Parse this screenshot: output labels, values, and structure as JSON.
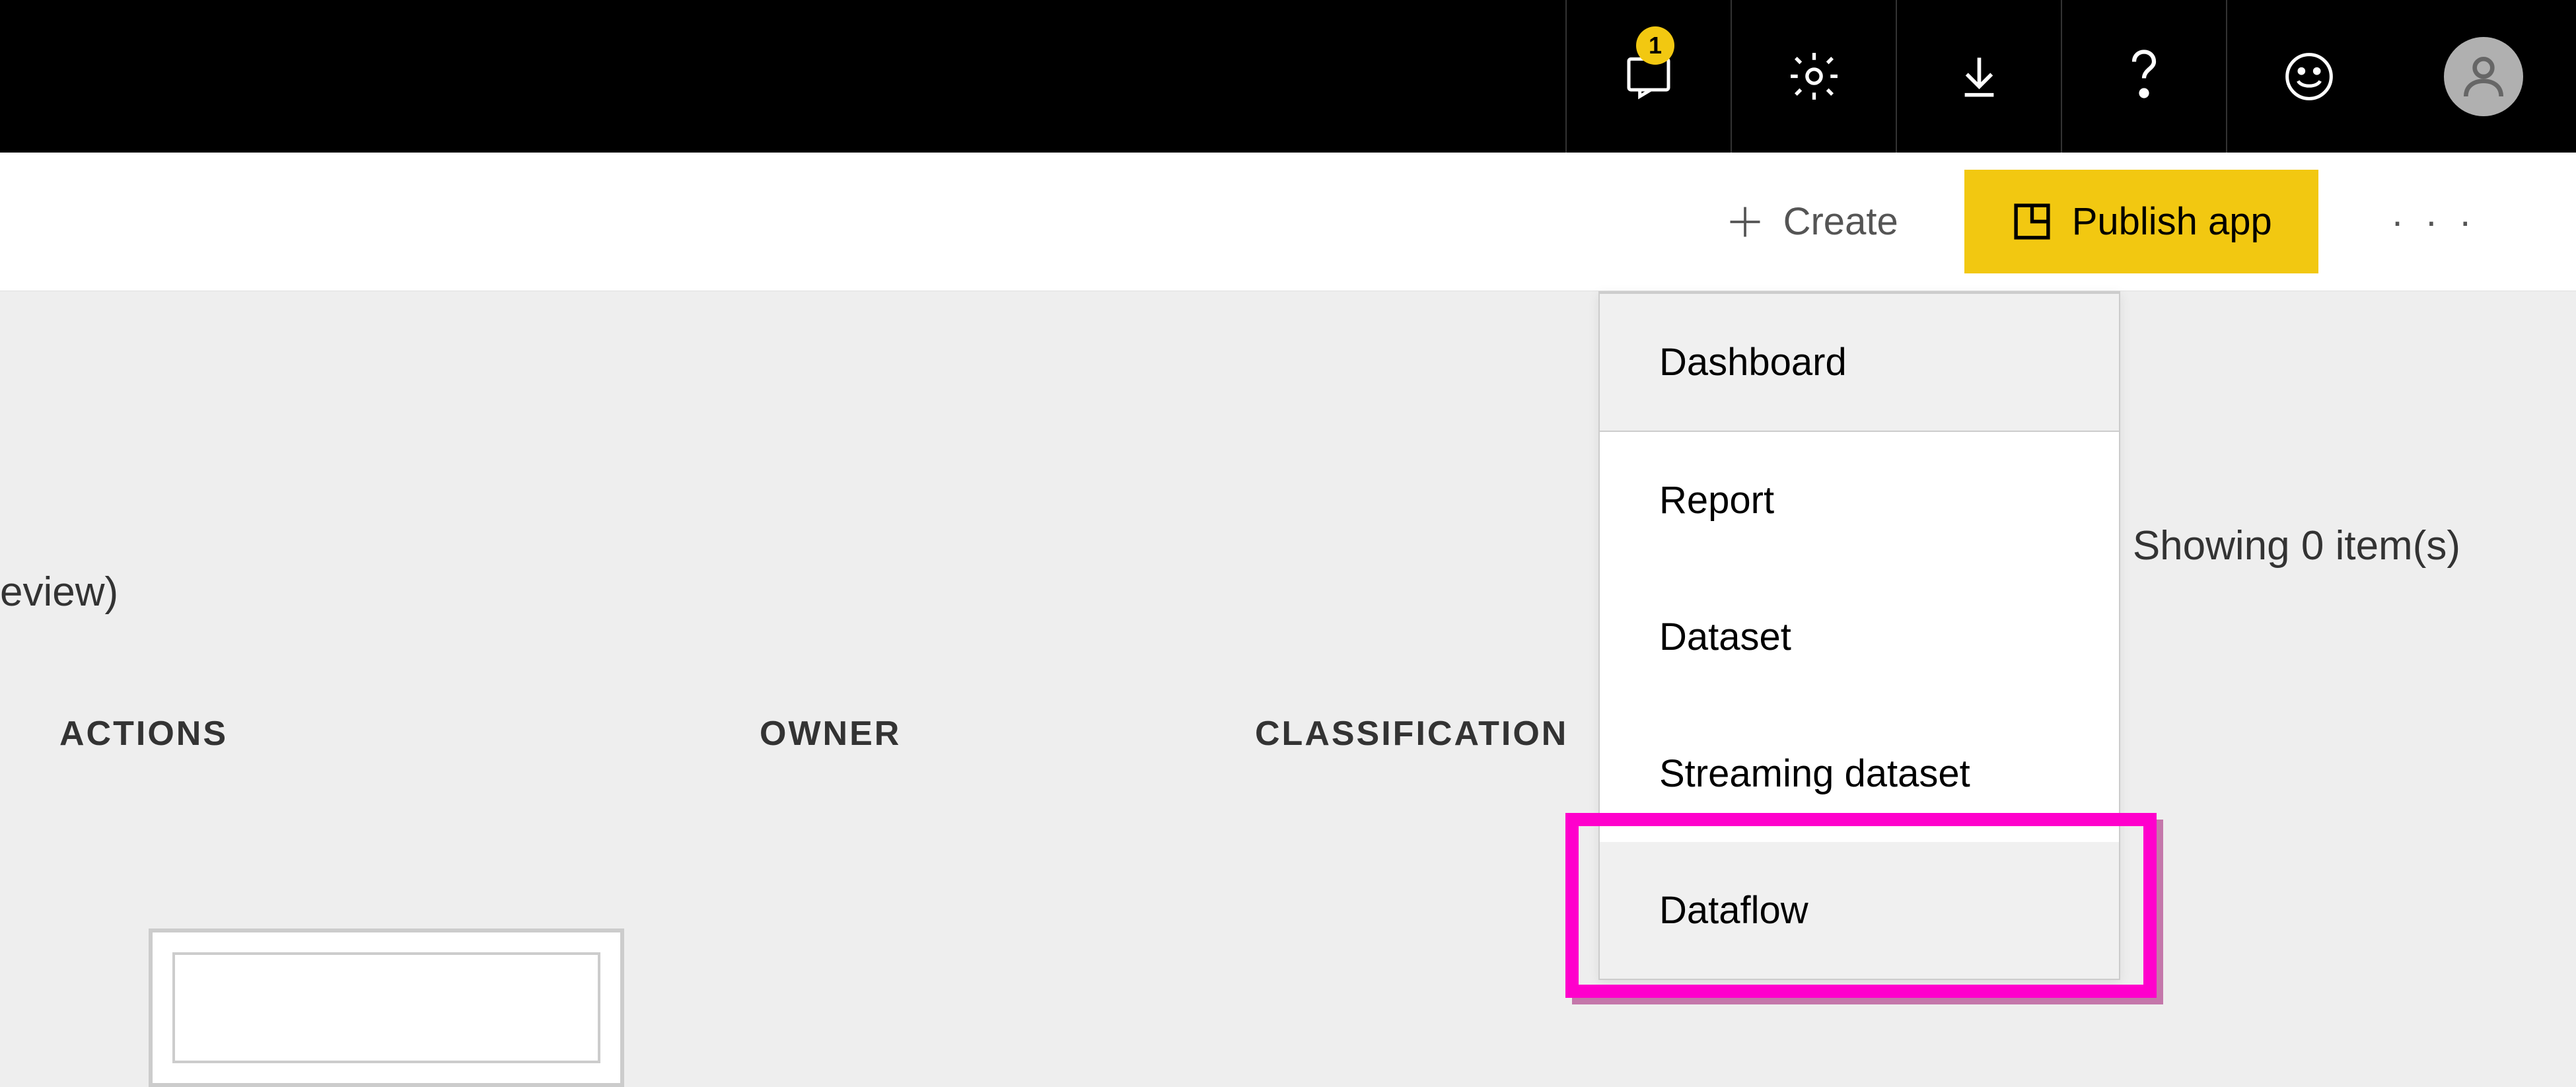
{
  "topbar": {
    "notification_count": "1"
  },
  "actionbar": {
    "create_label": "Create",
    "publish_label": "Publish app"
  },
  "content": {
    "partial_label": "eview)",
    "showing_label": "Showing 0 item(s)",
    "columns": {
      "actions": "ACTIONS",
      "owner": "OWNER",
      "classification": "CLASSIFICATION"
    }
  },
  "dropdown": {
    "items": [
      "Dashboard",
      "Report",
      "Dataset",
      "Streaming dataset",
      "Dataflow"
    ]
  }
}
